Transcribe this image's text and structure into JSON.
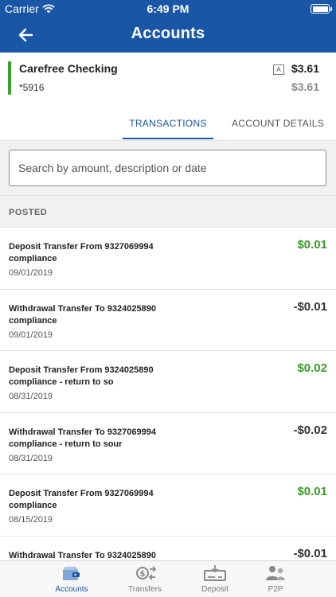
{
  "status_bar": {
    "carrier": "Carrier",
    "time": "6:49 PM"
  },
  "nav": {
    "title": "Accounts"
  },
  "account": {
    "name": "Carefree Checking",
    "number": "*5916",
    "badge": "A",
    "available_balance": "$3.61",
    "current_balance": "$3.61"
  },
  "tabs": {
    "transactions": "TRANSACTIONS",
    "account_details": "ACCOUNT DETAILS"
  },
  "search": {
    "placeholder": "Search by amount, description or date"
  },
  "section": {
    "posted": "POSTED"
  },
  "transactions": [
    {
      "line1": "Deposit Transfer From 9327069994",
      "line2": "compliance",
      "date": "09/01/2019",
      "amount": "$0.01",
      "type": "credit"
    },
    {
      "line1": "Withdrawal Transfer To 9324025890",
      "line2": "compliance",
      "date": "09/01/2019",
      "amount": "-$0.01",
      "type": "debit"
    },
    {
      "line1": "Deposit Transfer From 9324025890",
      "line2": "compliance - return to so",
      "date": "08/31/2019",
      "amount": "$0.02",
      "type": "credit"
    },
    {
      "line1": "Withdrawal Transfer To 9327069994",
      "line2": "compliance - return to sour",
      "date": "08/31/2019",
      "amount": "-$0.02",
      "type": "debit"
    },
    {
      "line1": "Deposit Transfer From 9327069994",
      "line2": "compliance",
      "date": "08/15/2019",
      "amount": "$0.01",
      "type": "credit"
    },
    {
      "line1": "Withdrawal Transfer To 9324025890",
      "line2": "",
      "date": "",
      "amount": "-$0.01",
      "type": "debit"
    }
  ],
  "tab_bar": {
    "accounts": "Accounts",
    "transfers": "Transfers",
    "deposit": "Deposit",
    "p2p": "P2P"
  },
  "colors": {
    "brand": "#1a56a6",
    "credit": "#3a9a2a",
    "accent": "#3aa02e"
  }
}
